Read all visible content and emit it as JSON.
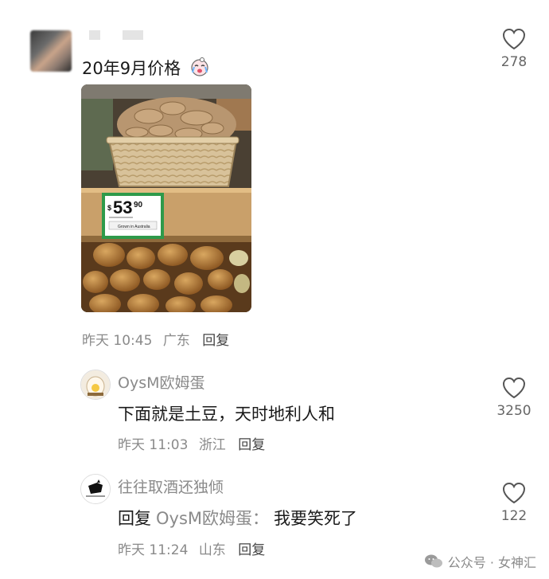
{
  "main_comment": {
    "text": "20年9月价格",
    "emoji": "crying-laughing-emoji",
    "time": "昨天 10:45",
    "location": "广东",
    "reply_label": "回复",
    "likes": "278",
    "photo": {
      "price_whole": "53",
      "price_cents": "90",
      "currency": "$",
      "origin_label": "Grown in Australia"
    }
  },
  "replies": [
    {
      "user": "OysM欧姆蛋",
      "text": "下面就是土豆，天时地利人和",
      "time": "昨天 11:03",
      "location": "浙江",
      "reply_label": "回复",
      "likes": "3250"
    },
    {
      "user": "往往取酒还独倾",
      "reply_prefix": "回复",
      "reply_to": "OysM欧姆蛋：",
      "text": "我要笑死了",
      "time": "昨天 11:24",
      "location": "山东",
      "reply_label": "回复",
      "likes": "122"
    }
  ],
  "watermark": {
    "text": "公众号 · 女神汇",
    "icon": "wechat-icon"
  },
  "colors": {
    "meta_gray": "#8a8a8a",
    "text_dark": "#1a1a1a",
    "heart_stroke": "#555555"
  }
}
